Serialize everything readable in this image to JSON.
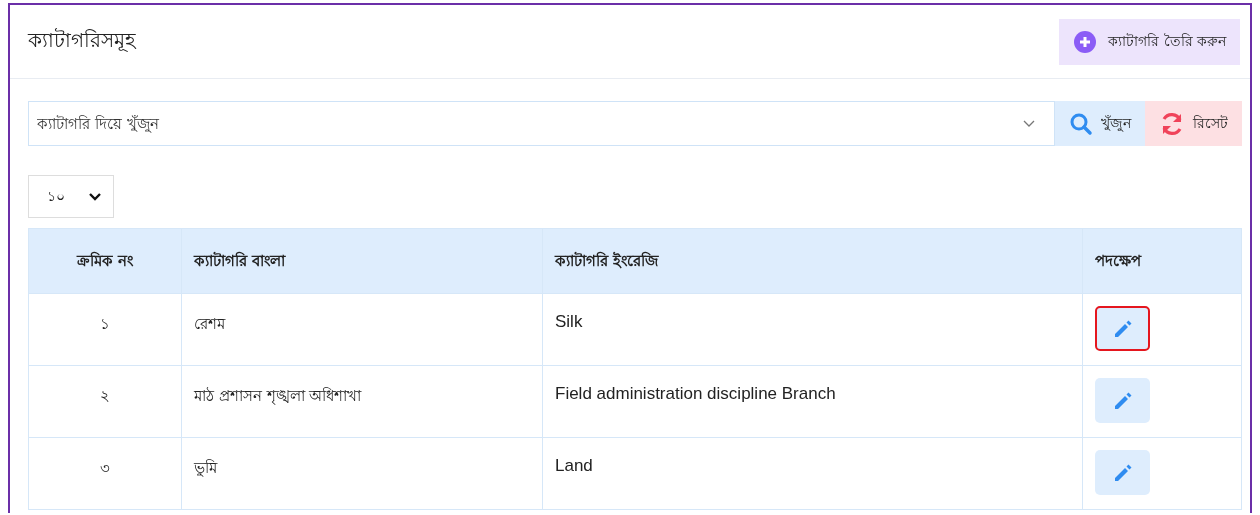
{
  "page": {
    "title": "ক্যাটাগরিসমূহ",
    "create_button": "ক্যাটাগরি তৈরি করুন"
  },
  "search": {
    "placeholder": "ক্যাটাগরি দিয়ে খুঁজুন",
    "search_button": "খুঁজুন",
    "reset_button": "রিসেট"
  },
  "page_size": {
    "value": "১০"
  },
  "table": {
    "columns": [
      "ক্রমিক নং",
      "ক্যাটাগরি বাংলা",
      "ক্যাটাগরি ইংরেজি",
      "পদক্ষেপ"
    ],
    "rows": [
      {
        "serial": "১",
        "name_bn": "রেশম",
        "name_en": "Silk",
        "edit_focused": true
      },
      {
        "serial": "২",
        "name_bn": "মাঠ প্রশাসন শৃঙ্খলা অধিশাখা",
        "name_en": "Field administration discipline Branch",
        "edit_focused": false
      },
      {
        "serial": "৩",
        "name_bn": "ভুমি",
        "name_en": "Land",
        "edit_focused": false
      }
    ]
  }
}
